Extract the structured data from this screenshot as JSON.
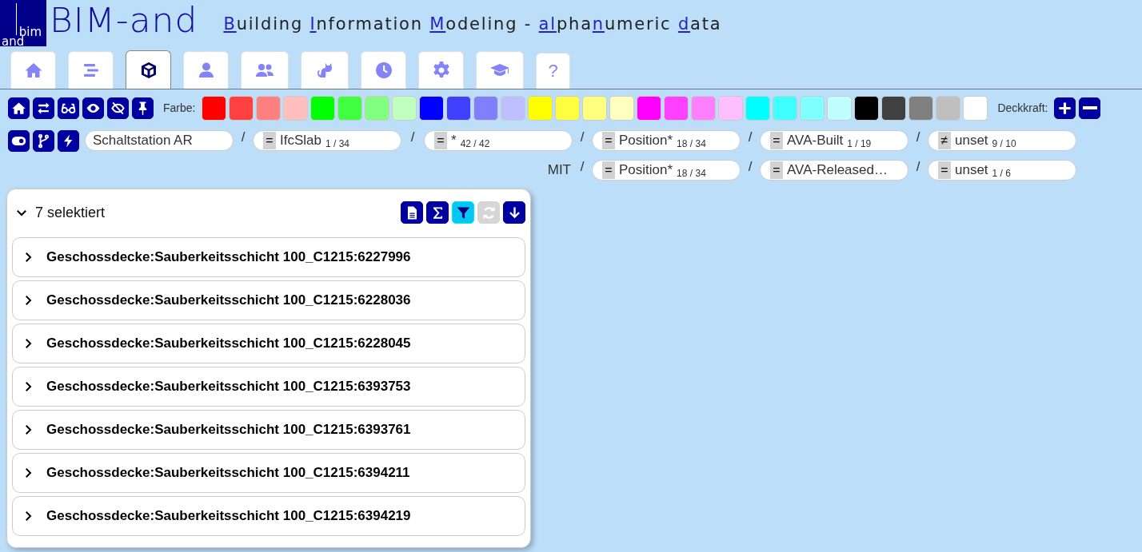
{
  "header": {
    "logo_top": "bim",
    "logo_bottom": "and",
    "brand": "BIM-and",
    "tagline": [
      {
        "text": "B",
        "accent": true
      },
      {
        "text": "uilding ",
        "accent": false
      },
      {
        "text": "I",
        "accent": true
      },
      {
        "text": "nformation ",
        "accent": false
      },
      {
        "text": "M",
        "accent": true
      },
      {
        "text": "odeling - ",
        "accent": false
      },
      {
        "text": "al",
        "accent": true
      },
      {
        "text": "pha",
        "accent": false
      },
      {
        "text": "n",
        "accent": true
      },
      {
        "text": "umeric ",
        "accent": false
      },
      {
        "text": "d",
        "accent": true
      },
      {
        "text": "ata",
        "accent": false
      }
    ]
  },
  "tabs": [
    {
      "selected": false
    },
    {
      "selected": false
    },
    {
      "selected": true
    },
    {
      "selected": false
    },
    {
      "selected": false
    },
    {
      "selected": false
    },
    {
      "selected": false
    },
    {
      "selected": false
    },
    {
      "selected": false
    },
    {
      "label": "?",
      "selected": false
    }
  ],
  "toolbar": {
    "color_label": "Farbe:",
    "opacity_label": "Deckkraft:",
    "swatches": [
      {
        "color": "#ff0000"
      },
      {
        "color": "#ff4040"
      },
      {
        "color": "#ff8080"
      },
      {
        "color": "#ffbfbf"
      },
      {
        "color": "#00ff00"
      },
      {
        "color": "#40ff40"
      },
      {
        "color": "#80ff80"
      },
      {
        "color": "#bfffbf"
      },
      {
        "color": "#0000ff"
      },
      {
        "color": "#4040ff"
      },
      {
        "color": "#8080ff"
      },
      {
        "color": "#bfbfff"
      },
      {
        "color": "#ffff00"
      },
      {
        "color": "#ffff40"
      },
      {
        "color": "#ffff80"
      },
      {
        "color": "#ffffbf"
      },
      {
        "color": "#ff00ff"
      },
      {
        "color": "#ff40ff"
      },
      {
        "color": "#ff80ff"
      },
      {
        "color": "#ffbfff"
      },
      {
        "color": "#00ffff"
      },
      {
        "color": "#40ffff"
      },
      {
        "color": "#80ffff"
      },
      {
        "color": "#bfffff"
      },
      {
        "color": "#000000"
      },
      {
        "color": "#404040"
      },
      {
        "color": "#808080"
      },
      {
        "color": "#bfbfbf"
      },
      {
        "color": "#ffffff"
      }
    ]
  },
  "filter": {
    "search": {
      "value": "Schaltstation AR"
    },
    "rows": [
      {
        "conditions": [
          {
            "operator": "=",
            "name": "IfcSlab",
            "count": "1 / 34"
          },
          {
            "operator": "=",
            "name": "*",
            "count": "42 / 42"
          },
          {
            "operator": "=",
            "name": "Position*",
            "count": "18 / 34"
          },
          {
            "operator": "=",
            "name": "AVA-Built",
            "count": "1 / 19"
          },
          {
            "operator": "≠",
            "name": "unset",
            "count": "9 / 10"
          }
        ]
      },
      {
        "label": "MIT",
        "conditions": [
          {
            "operator": "=",
            "name": "Position*",
            "count": "18 / 34"
          },
          {
            "operator": "=",
            "name": "AVA-Released…"
          },
          {
            "operator": "=",
            "name": "unset",
            "count": "1 / 6"
          }
        ]
      }
    ],
    "separator": "/"
  },
  "panel": {
    "title": "7 selektiert",
    "expanded": true,
    "tools": [
      {
        "active": false,
        "disabled": false
      },
      {
        "active": false,
        "disabled": false
      },
      {
        "active": true,
        "disabled": false
      },
      {
        "active": false,
        "disabled": true
      },
      {
        "active": false,
        "disabled": false
      }
    ],
    "items": [
      {
        "label": "Geschossdecke:Sauberkeitsschicht 100_C1215:6227996",
        "expanded": false
      },
      {
        "label": "Geschossdecke:Sauberkeitsschicht 100_C1215:6228036",
        "expanded": false
      },
      {
        "label": "Geschossdecke:Sauberkeitsschicht 100_C1215:6228045",
        "expanded": false
      },
      {
        "label": "Geschossdecke:Sauberkeitsschicht 100_C1215:6393753",
        "expanded": false
      },
      {
        "label": "Geschossdecke:Sauberkeitsschicht 100_C1215:6393761",
        "expanded": false
      },
      {
        "label": "Geschossdecke:Sauberkeitsschicht 100_C1215:6394211",
        "expanded": false
      },
      {
        "label": "Geschossdecke:Sauberkeitsschicht 100_C1215:6394219",
        "expanded": false
      }
    ]
  }
}
